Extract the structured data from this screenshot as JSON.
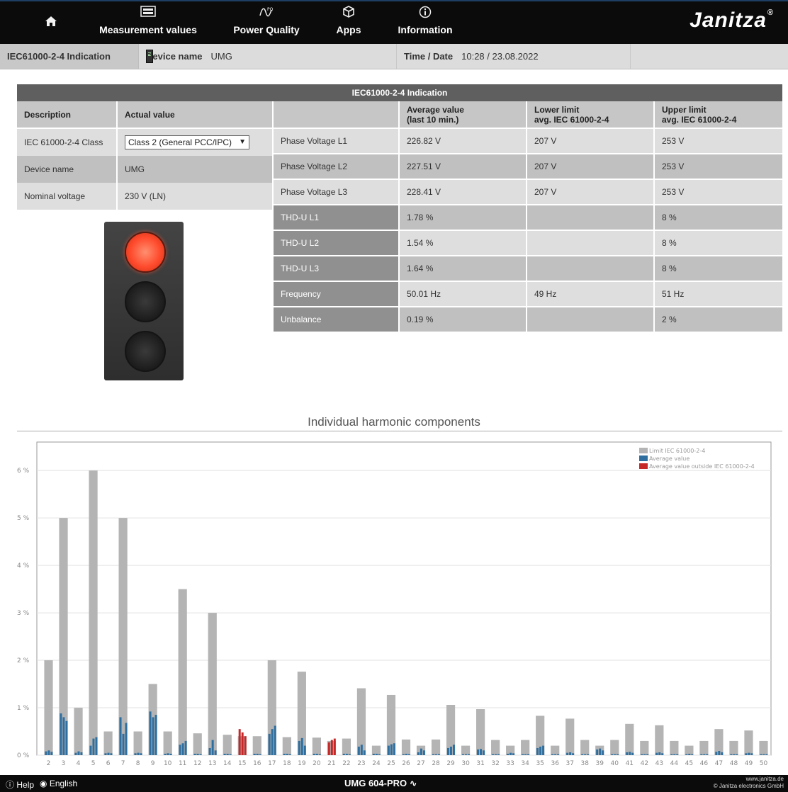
{
  "nav": {
    "home_icon": "home-icon",
    "items": [
      {
        "label": "Measurement values",
        "icon": "meter-display-icon"
      },
      {
        "label": "Power Quality",
        "icon": "pq-wave-icon"
      },
      {
        "label": "Apps",
        "icon": "cube-icon"
      },
      {
        "label": "Information",
        "icon": "info-circle-icon"
      }
    ],
    "logo": "Janitza",
    "logo_mark": "®"
  },
  "infobar": {
    "title": "IEC61000-2-4 Indication",
    "device_label": "Device name",
    "device_value": "UMG",
    "time_label": "Time / Date",
    "time_value": "10:28 / 23.08.2022"
  },
  "table": {
    "title": "IEC61000-2-4 Indication",
    "left_headers": {
      "description": "Description",
      "actual": "Actual value"
    },
    "left_rows": [
      {
        "label": "IEC 61000-2-4 Class",
        "value": "Class 2 (General PCC/IPC)"
      },
      {
        "label": "Device name",
        "value": "UMG"
      },
      {
        "label": "Nominal voltage",
        "value": "230 V (LN)"
      }
    ],
    "right_headers": {
      "average": "Average value\n(last 10 min.)",
      "lower": "Lower limit\navg. IEC 61000-2-4",
      "upper": "Upper limit\navg. IEC 61000-2-4"
    },
    "right_rows": [
      {
        "name": "Phase Voltage L1",
        "avg": "226.82 V",
        "lower": "207 V",
        "upper": "253 V"
      },
      {
        "name": "Phase Voltage L2",
        "avg": "227.51 V",
        "lower": "207 V",
        "upper": "253 V"
      },
      {
        "name": "Phase Voltage L3",
        "avg": "228.41 V",
        "lower": "207 V",
        "upper": "253 V"
      },
      {
        "name": "THD-U L1",
        "avg": "1.78 %",
        "lower": "",
        "upper": "8 %"
      },
      {
        "name": "THD-U L2",
        "avg": "1.54 %",
        "lower": "",
        "upper": "8 %"
      },
      {
        "name": "THD-U L3",
        "avg": "1.64 %",
        "lower": "",
        "upper": "8 %"
      },
      {
        "name": "Frequency",
        "avg": "50.01 Hz",
        "lower": "49 Hz",
        "upper": "51 Hz"
      },
      {
        "name": "Unbalance",
        "avg": "0.19 %",
        "lower": "",
        "upper": "2 %"
      }
    ],
    "traffic_light_state": "red"
  },
  "chart_title": "Individual harmonic components",
  "chart_data": {
    "type": "bar",
    "title": "Individual harmonic components",
    "xlabel": "",
    "ylabel": "",
    "ylim": [
      0,
      6.6
    ],
    "yticks": [
      0,
      1,
      2,
      3,
      4,
      5,
      6
    ],
    "ytick_labels": [
      "0 %",
      "1 %",
      "2 %",
      "3 %",
      "4 %",
      "5 %",
      "6 %"
    ],
    "grid": true,
    "legend_position": "top-right",
    "categories": [
      "2",
      "3",
      "4",
      "5",
      "6",
      "7",
      "8",
      "9",
      "10",
      "11",
      "12",
      "13",
      "14",
      "15",
      "16",
      "17",
      "18",
      "19",
      "20",
      "21",
      "22",
      "23",
      "24",
      "25",
      "26",
      "27",
      "28",
      "29",
      "30",
      "31",
      "32",
      "33",
      "34",
      "35",
      "36",
      "37",
      "38",
      "39",
      "40",
      "41",
      "42",
      "43",
      "44",
      "45",
      "46",
      "47",
      "48",
      "49",
      "50"
    ],
    "series": [
      {
        "name": "Limit IEC 61000-2-4",
        "color": "#b4b4b4",
        "values": [
          2.0,
          5.0,
          1.0,
          6.0,
          0.5,
          5.0,
          0.5,
          1.5,
          0.5,
          3.5,
          0.46,
          3.0,
          0.43,
          0.4,
          0.4,
          2.0,
          0.38,
          1.76,
          0.37,
          0.3,
          0.35,
          1.41,
          0.2,
          1.27,
          0.33,
          0.2,
          0.33,
          1.06,
          0.2,
          0.97,
          0.32,
          0.2,
          0.32,
          0.83,
          0.2,
          0.77,
          0.32,
          0.2,
          0.32,
          0.66,
          0.3,
          0.63,
          0.3,
          0.2,
          0.3,
          0.55,
          0.3,
          0.52,
          0.3
        ]
      },
      {
        "name": "Average value",
        "color": "#2f6f9f",
        "phases": [
          [
            0.08,
            0.88,
            0.05,
            0.2,
            0.04,
            0.8,
            0.04,
            0.92,
            0.03,
            0.22,
            0.03,
            0.15,
            0.03,
            0.0,
            0.03,
            0.45,
            0.03,
            0.3,
            0.03,
            0.0,
            0.03,
            0.18,
            0.03,
            0.2,
            0.02,
            0.06,
            0.02,
            0.15,
            0.02,
            0.12,
            0.02,
            0.03,
            0.02,
            0.15,
            0.02,
            0.05,
            0.02,
            0.12,
            0.02,
            0.06,
            0.02,
            0.05,
            0.02,
            0.02,
            0.02,
            0.07,
            0.02,
            0.04,
            0.02
          ],
          [
            0.1,
            0.8,
            0.08,
            0.35,
            0.05,
            0.45,
            0.05,
            0.8,
            0.04,
            0.25,
            0.03,
            0.32,
            0.03,
            0.0,
            0.03,
            0.55,
            0.03,
            0.36,
            0.03,
            0.0,
            0.03,
            0.22,
            0.03,
            0.23,
            0.03,
            0.14,
            0.02,
            0.18,
            0.02,
            0.13,
            0.02,
            0.05,
            0.02,
            0.18,
            0.02,
            0.06,
            0.02,
            0.14,
            0.02,
            0.07,
            0.02,
            0.06,
            0.02,
            0.03,
            0.02,
            0.09,
            0.02,
            0.05,
            0.02
          ],
          [
            0.07,
            0.72,
            0.06,
            0.38,
            0.04,
            0.68,
            0.04,
            0.85,
            0.03,
            0.3,
            0.02,
            0.1,
            0.02,
            0.0,
            0.02,
            0.62,
            0.02,
            0.2,
            0.02,
            0.0,
            0.02,
            0.1,
            0.02,
            0.25,
            0.02,
            0.1,
            0.02,
            0.22,
            0.02,
            0.1,
            0.02,
            0.04,
            0.02,
            0.2,
            0.02,
            0.04,
            0.02,
            0.1,
            0.02,
            0.05,
            0.02,
            0.04,
            0.02,
            0.02,
            0.02,
            0.06,
            0.02,
            0.04,
            0.02
          ]
        ]
      },
      {
        "name": "Average value outside IEC 61000-2-4",
        "color": "#c62828",
        "phases_by_category": {
          "15": [
            0.55,
            0.48,
            0.4
          ],
          "21": [
            0.27,
            0.32,
            0.35
          ]
        }
      }
    ]
  },
  "footer": {
    "help": "Help",
    "language": "English",
    "product": "UMG 604-PRO",
    "url": "www.janitza.de",
    "copyright": "© Janitza electronics GmbH"
  }
}
